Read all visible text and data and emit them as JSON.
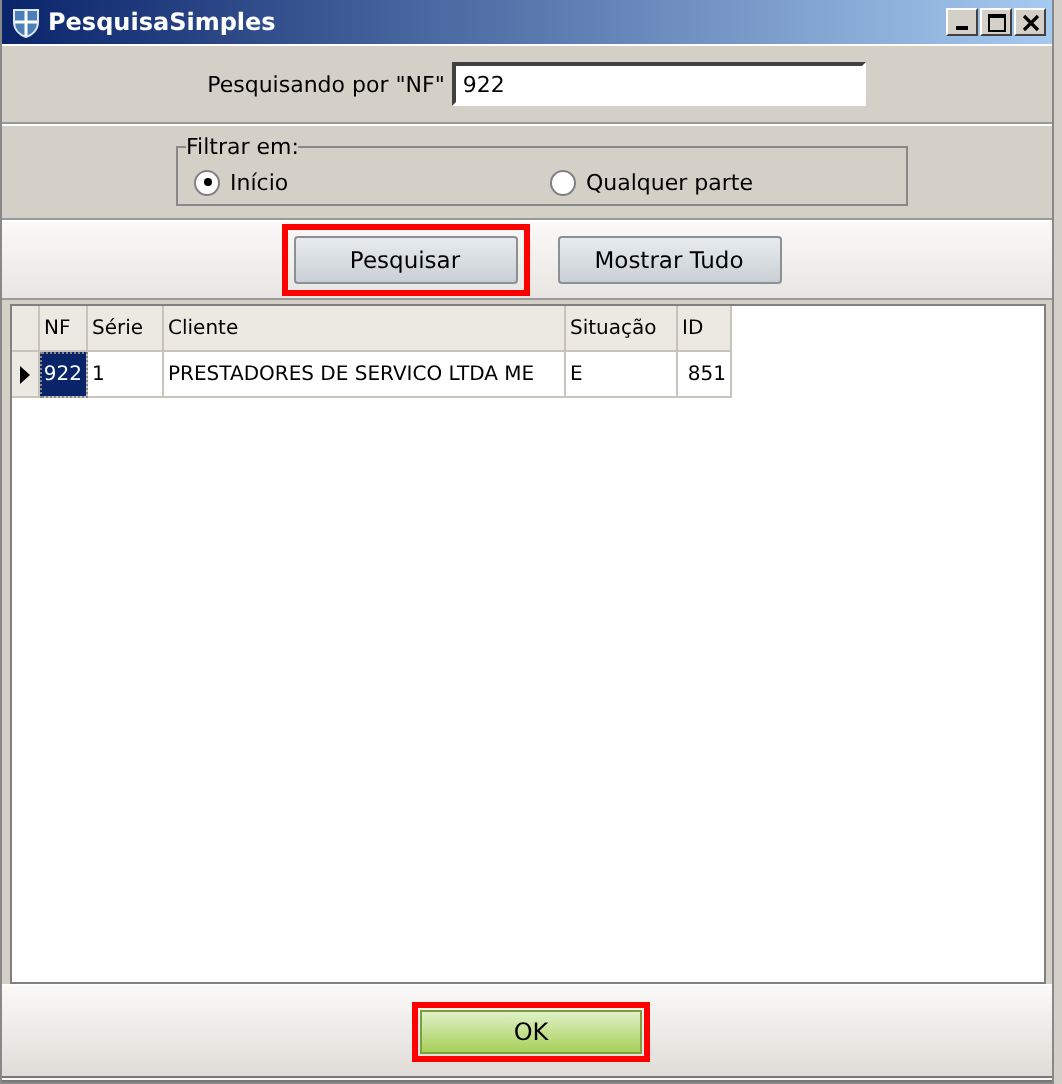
{
  "window": {
    "title": "PesquisaSimples"
  },
  "search": {
    "label": "Pesquisando por \"NF\"",
    "value": "922"
  },
  "filter": {
    "legend": "Filtrar em:",
    "options": [
      {
        "label": "Início",
        "selected": true
      },
      {
        "label": "Qualquer parte",
        "selected": false
      }
    ]
  },
  "buttons": [
    {
      "label": "Pesquisar",
      "highlighted": true
    },
    {
      "label": "Mostrar Tudo",
      "highlighted": false
    }
  ],
  "table": {
    "columns": [
      "NF",
      "Série",
      "Cliente",
      "Situação",
      "ID"
    ],
    "rows": [
      {
        "selected": true,
        "cells": [
          "922",
          "1",
          "PRESTADORES DE SERVICO LTDA ME",
          "E",
          "851"
        ]
      }
    ]
  },
  "ok_button": {
    "label": "OK",
    "highlighted": true
  }
}
